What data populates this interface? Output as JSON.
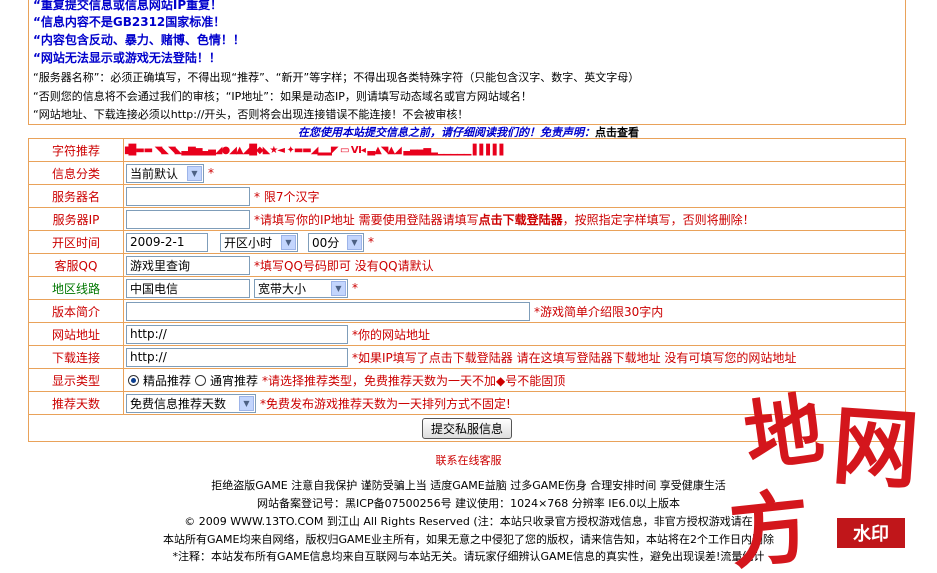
{
  "notices": {
    "blue": [
      "“重复提交信息或信息网站IP重复！",
      "“信息内容不是GB2312国家标准！",
      "“内容包含反动、暴力、赌博、色情！！",
      "“网站无法显示或游戏无法登陆！！"
    ],
    "black": [
      "“服务器名称”：必须正确填写，不得出现“推荐”、“新开”等字样；不得出现各类特殊字符（只能包含汉字、数字、英文字母）",
      "“否则您的信息将不会通过我们的审核；“IP地址”：如果是动态IP，则请填写动态域名或官方网站域名！",
      "“网站地址、下载连接必须以http://开头，否则将会出现连接错误不能连接！不会被审核！"
    ]
  },
  "disclaimer": {
    "blue_text": "在您使用本站提交信息之前，请仔细阅读我们的！免责声明：",
    "link_text": "点击查看"
  },
  "form": {
    "symbol": {
      "label": "字符推荐"
    },
    "category": {
      "label": "信息分类",
      "value": "当前默认",
      "hint": "*"
    },
    "server_name": {
      "label": "服务器名",
      "value": "",
      "hint": "* 限7个汉字"
    },
    "server_ip": {
      "label": "服务器IP",
      "value": "",
      "hint_prefix": "*请填写你的IP地址 需要使用登陆器请填写",
      "hint_bold": "点击下载登陆器",
      "hint_suffix": "，按照指定字样填写，否则将删除！"
    },
    "open_time": {
      "label": "开区时间",
      "date": "2009-2-1",
      "hour": "开区小时",
      "minute": "00分",
      "hint": "*"
    },
    "service_qq": {
      "label": "客服QQ",
      "value": "游戏里查询",
      "hint": "*填写QQ号码即可 没有QQ请默认"
    },
    "line": {
      "label": "地区线路",
      "value": "中国电信",
      "select": "宽带大小",
      "hint": "*"
    },
    "intro": {
      "label": "版本简介",
      "value": "",
      "hint": "*游戏简单介绍限30字内"
    },
    "website": {
      "label": "网站地址",
      "value": "http://",
      "hint": "*你的网站地址"
    },
    "download": {
      "label": "下载连接",
      "value": "http://",
      "hint": "*如果IP填写了点击下载登陆器 请在这填写登陆器下载地址 没有可填写您的网站地址"
    },
    "display": {
      "label": "显示类型",
      "option1": "精品推荐",
      "option2": "通宵推荐",
      "hint": "*请选择推荐类型，免费推荐天数为一天不加◆号不能固顶"
    },
    "days": {
      "label": "推荐天数",
      "value": "免费信息推荐天数",
      "hint": "*免费发布游戏推荐天数为一天排列方式不固定!"
    },
    "submit_label": "提交私服信息"
  },
  "service_link": "联系在线客服",
  "footer": [
    "拒绝盗版GAME 注意自我保护 谨防受骗上当 适度GAME益脑 过多GAME伤身 合理安排时间 享受健康生活",
    "网站备案登记号：黑ICP备07500256号   建议使用：1024×768 分辨率   IE6.0以上版本",
    "© 2009 WWW.13TO.COM 到江山  All Rights Reserved (注：本站只收录官方授权游戏信息，非官方授权游戏请在",
    "本站所有GAME均来自网络，版权归GAME业主所有，如果无意之中侵犯了您的版权，请来信告知，本站将在2个工作日内删除",
    "*注释：本站发布所有GAME信息均来自互联网与本站无关。请玩家仔细辨认GAME信息的真实性，避免出现误差!流量统计"
  ],
  "watermark": {
    "text": "水印",
    "brand_chars": [
      "地",
      "网",
      "方"
    ]
  },
  "colors": {
    "border": "#e9a25a",
    "label_red": "#cc0000",
    "notice_blue": "#0000cc",
    "symbols_red": "#e8001c"
  }
}
